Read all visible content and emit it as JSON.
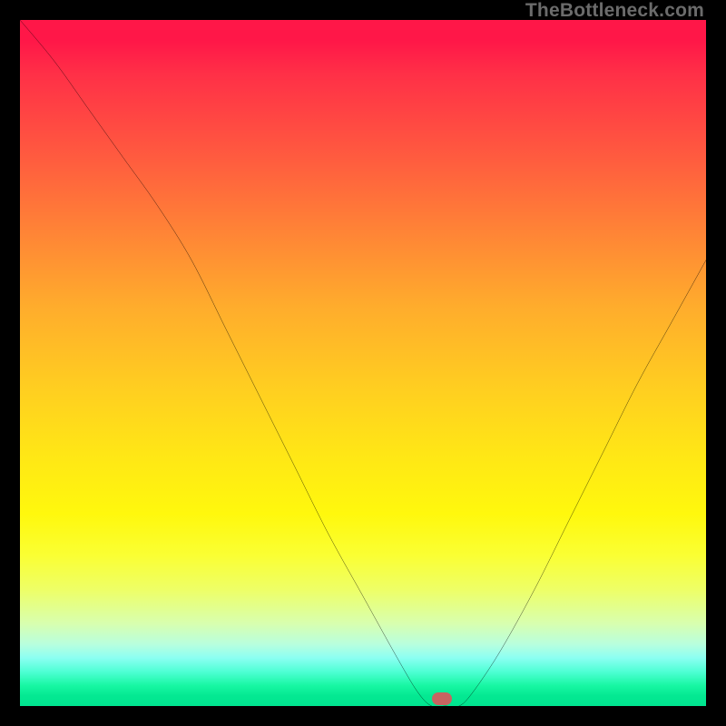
{
  "watermark": "TheBottleneck.com",
  "marker": {
    "x_pct": 61.5,
    "y_pct": 99.0
  },
  "colors": {
    "frame": "#000000",
    "marker": "#c76461",
    "curve": "#000000"
  },
  "chart_data": {
    "type": "line",
    "title": "",
    "xlabel": "",
    "ylabel": "",
    "xlim": [
      0,
      100
    ],
    "ylim": [
      0,
      100
    ],
    "grid": false,
    "series": [
      {
        "name": "curve",
        "x": [
          0,
          5,
          10,
          15,
          20,
          25,
          30,
          35,
          40,
          45,
          50,
          55,
          58,
          60,
          62,
          64,
          66,
          70,
          75,
          80,
          85,
          90,
          95,
          100
        ],
        "y": [
          100,
          94,
          87,
          80,
          73,
          65,
          55,
          45,
          35,
          25,
          16,
          7,
          2,
          0,
          0,
          0,
          2,
          8,
          17,
          27,
          37,
          47,
          56,
          65
        ]
      }
    ],
    "annotations": [
      {
        "type": "marker",
        "x": 61.5,
        "y": 1.0,
        "shape": "rounded"
      }
    ],
    "background_gradient_stops": [
      {
        "pct": 0,
        "color": "#ff1748"
      },
      {
        "pct": 20,
        "color": "#ff5b3f"
      },
      {
        "pct": 42,
        "color": "#ffad2c"
      },
      {
        "pct": 64,
        "color": "#ffe815"
      },
      {
        "pct": 83,
        "color": "#eeff66"
      },
      {
        "pct": 95,
        "color": "#4effd4"
      },
      {
        "pct": 100,
        "color": "#00e48f"
      }
    ]
  }
}
